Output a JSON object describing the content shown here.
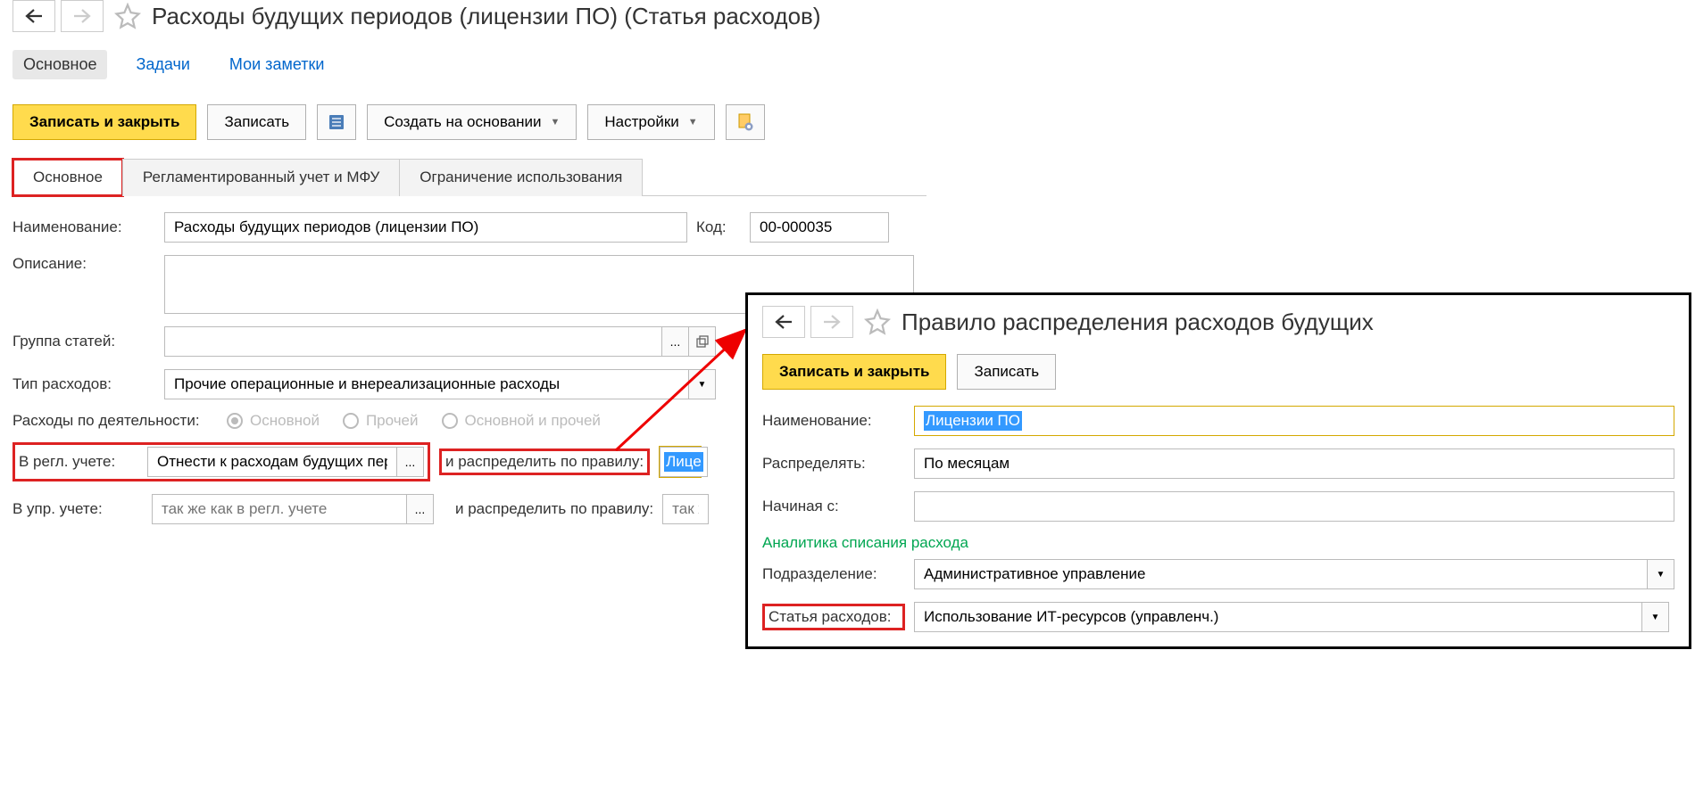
{
  "main": {
    "title": "Расходы будущих периодов (лицензии ПО) (Статья расходов)",
    "navTabs": {
      "main": "Основное",
      "tasks": "Задачи",
      "notes": "Мои заметки"
    },
    "toolbar": {
      "saveClose": "Записать и закрыть",
      "save": "Записать",
      "createBased": "Создать на основании",
      "settings": "Настройки"
    },
    "formTabs": {
      "main": "Основное",
      "regAcc": "Регламентированный учет и МФУ",
      "restrict": "Ограничение использования"
    },
    "labels": {
      "name": "Наименование:",
      "code": "Код:",
      "desc": "Описание:",
      "group": "Группа статей:",
      "type": "Тип расходов:",
      "activity": "Расходы по деятельности:",
      "regAcc": "В регл. учете:",
      "mgmtAcc": "В упр. учете:",
      "distribRule": "и распределить по правилу:"
    },
    "values": {
      "name": "Расходы будущих периодов (лицензии ПО)",
      "code": "00-000035",
      "type": "Прочие операционные и внереализационные расходы",
      "regAccValue": "Отнести к расходам будущих пер",
      "distribRuleValue": "Лице"
    },
    "radios": {
      "main": "Основной",
      "other": "Прочей",
      "both": "Основной и прочей"
    },
    "placeholders": {
      "mgmtAcc": "так же как в регл. учете",
      "mgmtDistrib": "так ж"
    }
  },
  "overlay": {
    "title": "Правило распределения расходов будущих",
    "toolbar": {
      "saveClose": "Записать и закрыть",
      "save": "Записать"
    },
    "labels": {
      "name": "Наименование:",
      "distribute": "Распределять:",
      "startFrom": "Начиная с:",
      "analytics": "Аналитика списания расхода",
      "division": "Подразделение:",
      "expenseItem": "Статья расходов:"
    },
    "values": {
      "name": "Лицензии ПО",
      "distribute": "По месяцам",
      "division": "Административное управление",
      "expenseItem": "Использование ИТ-ресурсов (управленч.)"
    }
  }
}
